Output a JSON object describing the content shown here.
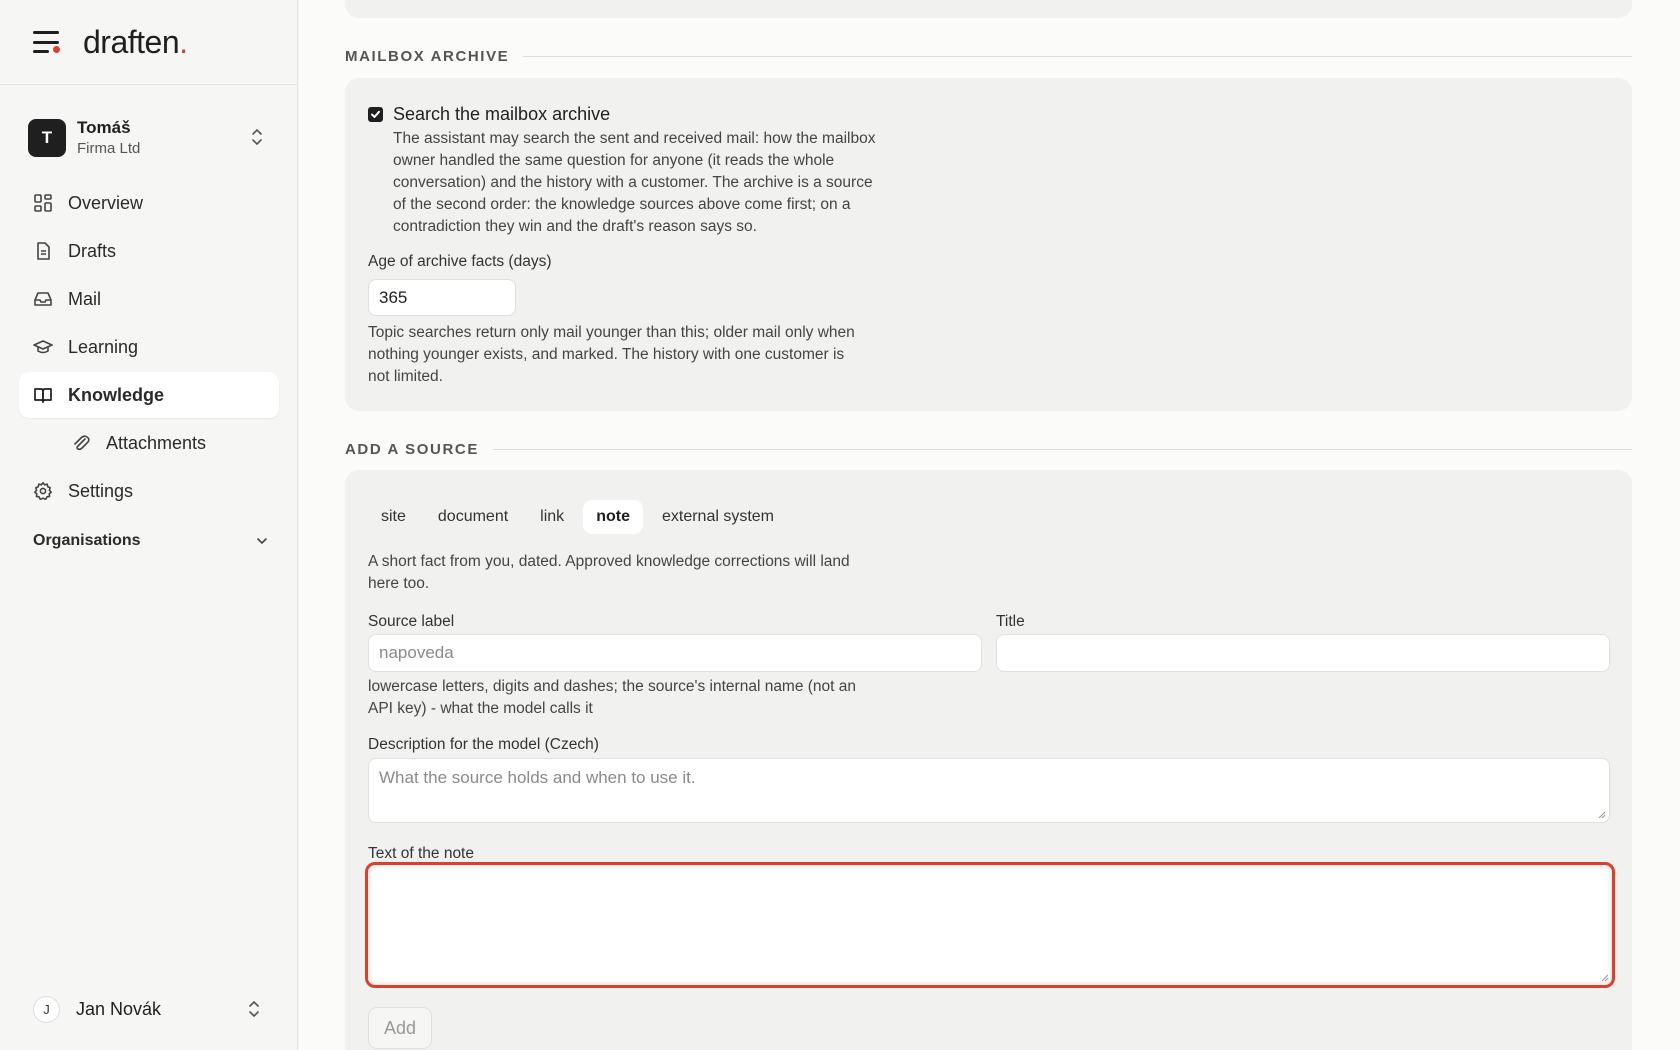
{
  "brand": {
    "name": "draften",
    "dot": "."
  },
  "account": {
    "initial": "T",
    "name": "Tomáš",
    "org": "Firma Ltd"
  },
  "nav": {
    "overview": "Overview",
    "drafts": "Drafts",
    "mail": "Mail",
    "learning": "Learning",
    "knowledge": "Knowledge",
    "attachments": "Attachments",
    "settings": "Settings"
  },
  "organisations_label": "Organisations",
  "user": {
    "initial": "J",
    "name": "Jan Novák"
  },
  "colors": {
    "accent": "#d9412a",
    "dark": "#1f1f1f"
  },
  "mailbox_archive": {
    "heading": "MAILBOX ARCHIVE",
    "checkbox_label": "Search the mailbox archive",
    "checked": true,
    "description_lines": [
      "The assistant may search the sent and received mail: how the mailbox",
      "owner handled the same question for anyone (it reads the whole",
      "conversation) and the history with a customer. The archive is a source",
      "of the second order: the knowledge sources above come first; on a",
      "contradiction they win and the draft's reason says so."
    ],
    "age_label": "Age of archive facts (days)",
    "age_value": "365",
    "help_lines": [
      "Topic searches return only mail younger than this; older mail only when",
      "nothing younger exists, and marked. The history with one customer is",
      "not limited."
    ]
  },
  "add_source": {
    "heading": "ADD A SOURCE",
    "tabs": [
      "site",
      "document",
      "link",
      "note",
      "external system"
    ],
    "active_tab": "note",
    "intro_lines": [
      "A short fact from you, dated. Approved knowledge corrections will land",
      "here too."
    ],
    "source_label_label": "Source label",
    "source_label_placeholder": "napoveda",
    "title_label": "Title",
    "title_value": "",
    "source_help_lines": [
      "lowercase letters, digits and dashes; the source's internal name (not an",
      "API key) - what the model calls it"
    ],
    "description_label": "Description for the model (Czech)",
    "description_placeholder": "What the source holds and when to use it.",
    "note_label": "Text of the note",
    "note_value": "",
    "add_button": "Add"
  }
}
